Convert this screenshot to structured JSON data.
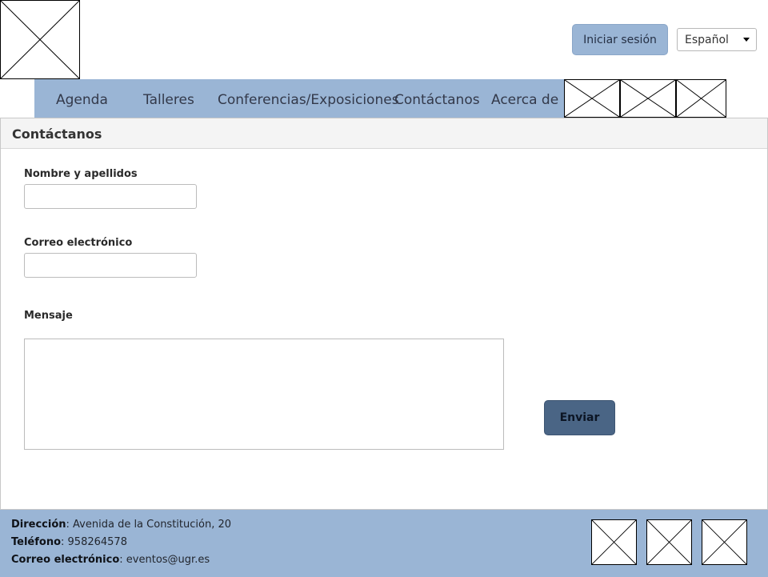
{
  "header": {
    "logo_icon": "image-placeholder-icon",
    "login_label": "Iniciar sesión",
    "language_selected": "Español"
  },
  "nav": {
    "items": [
      {
        "label": "Agenda"
      },
      {
        "label": "Talleres"
      },
      {
        "label": "Conferencias/Exposiciones"
      },
      {
        "label": "Contáctanos"
      },
      {
        "label": "Acerca de"
      }
    ],
    "extra_icons": [
      "image-placeholder-icon",
      "image-placeholder-icon",
      "image-placeholder-icon"
    ]
  },
  "contact": {
    "title": "Contáctanos",
    "name_label": "Nombre y apellidos",
    "name_value": "",
    "email_label": "Correo electrónico",
    "email_value": "",
    "message_label": "Mensaje",
    "message_value": "",
    "send_label": "Enviar"
  },
  "footer": {
    "address_label": "Dirección",
    "address_value": ": Avenida de la Constitución, 20",
    "phone_label": "Teléfono",
    "phone_value": ": 958264578",
    "email_label": "Correo electrónico",
    "email_value": ": eventos@ugr.es",
    "social_icons": [
      "image-placeholder-icon",
      "image-placeholder-icon",
      "image-placeholder-icon"
    ]
  },
  "colors": {
    "accent": "#9ab5d5",
    "button_dark": "#4a6585",
    "panel_header": "#f4f4f4"
  }
}
